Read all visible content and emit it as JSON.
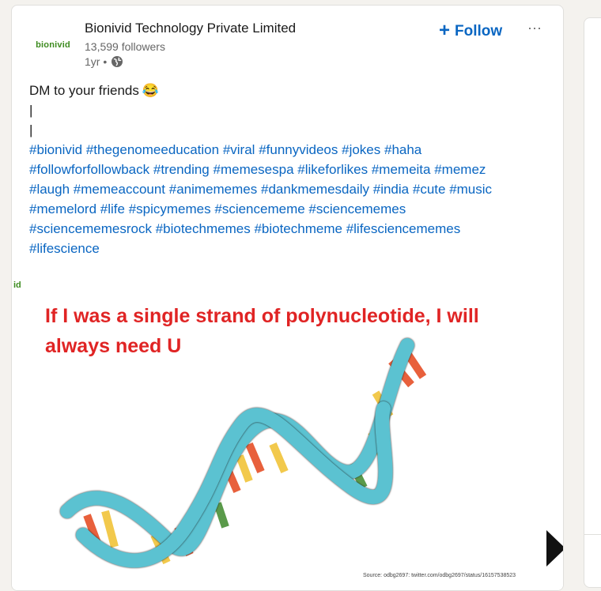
{
  "post": {
    "company_name": "Bionivid Technology Private Limited",
    "logo_text": "bionivid",
    "followers": "13,599 followers",
    "time": "1yr •",
    "follow_label": "Follow",
    "more_label": "···",
    "text_lines": [
      "DM to your friends",
      "|",
      "|"
    ],
    "emoji": "😂",
    "hashtags": [
      [
        "#bionivid",
        "#thegenomeeducation",
        "#viral",
        "#funnyvideos",
        "#jokes",
        "#haha"
      ],
      [
        "#followforfollowback",
        "#trending",
        "#memesespa",
        "#likeforlikes",
        "#memeita",
        "#memez"
      ],
      [
        "#laugh",
        "#memeaccount",
        "#animememes",
        "#dankmemesdaily",
        "#india",
        "#cute",
        "#music"
      ],
      [
        "#memelord",
        "#life",
        "#spicymemes",
        "#sciencememe",
        "#sciencememes"
      ],
      [
        "#sciencememesrock",
        "#biotechmemes",
        "#biotechmeme",
        "#lifesciencememes"
      ],
      [
        "#lifescience"
      ]
    ]
  },
  "media": {
    "logo_fragment": "id",
    "meme_lines": [
      "If I was a single strand of polynucleotide, I will",
      "always need U"
    ],
    "source": "Source: odbg2697: twitter.com/odbg2697/status/16157538523",
    "colors": {
      "strand": "#5bc2d1",
      "strand_outline": "#1a1a1a",
      "red": "#e8603c",
      "yellow": "#f2c94c",
      "green": "#5a9a4a",
      "text_red": "#e02424"
    }
  },
  "colors": {
    "accent": "#0a66c2",
    "brand": "#3d8b1f"
  }
}
